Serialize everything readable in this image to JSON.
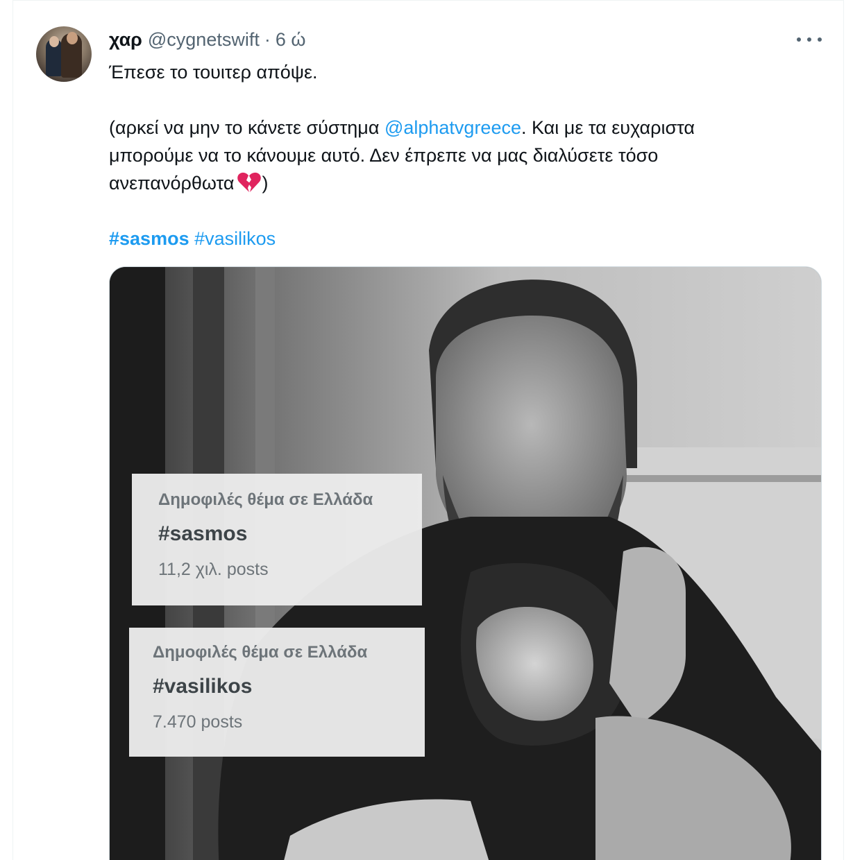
{
  "tweet": {
    "author_name": "χαρ",
    "handle": "@cygnetswift",
    "separator": "·",
    "time": "6 ώ",
    "line1": "Έπεσε το τουιτερ απόψε.",
    "line2_pre": "(αρκεί να μην το κάνετε σύστημα ",
    "mention": "@alphatvgreece",
    "line2_post": ". Και με τα ευχαριστα",
    "line3": "μπορούμε να το κάνουμε αυτό. Δεν έπρεπε να μας διαλύσετε τόσο",
    "line4": "ανεπανόρθωτα",
    "line4_close": ")",
    "hashtag1": "#sasmos",
    "hashtag2": "#vasilikos"
  },
  "icons": {
    "more": "more-dots-icon",
    "heart": "broken-heart-icon"
  },
  "media": {
    "trend1": {
      "label": "Δημοφιλές θέμα σε Ελλάδα",
      "tag": "#sasmos",
      "count": "11,2 χιλ. posts"
    },
    "trend2": {
      "label": "Δημοφιλές θέμα σε Ελλάδα",
      "tag": "#vasilikos",
      "count": "7.470 posts"
    }
  },
  "colors": {
    "link": "#1d9bf0",
    "text": "#0f1419",
    "muted": "#536471"
  }
}
